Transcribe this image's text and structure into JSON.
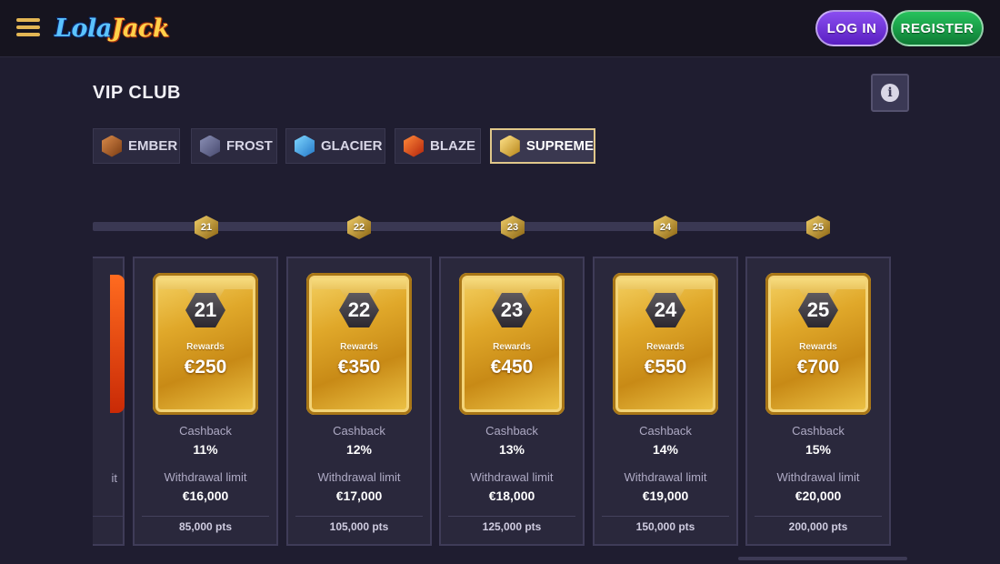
{
  "header": {
    "logo_part1": "Lola",
    "logo_part2": "Jack",
    "login_label": "LOG IN",
    "register_label": "REGISTER"
  },
  "page": {
    "title": "VIP CLUB",
    "info_icon": "i"
  },
  "tabs": [
    {
      "label": "EMBER",
      "icon": "ember-gem-icon"
    },
    {
      "label": "FROST",
      "icon": "frost-gem-icon"
    },
    {
      "label": "GLACIER",
      "icon": "glacier-gem-icon"
    },
    {
      "label": "BLAZE",
      "icon": "blaze-gem-icon"
    },
    {
      "label": "SUPREME",
      "icon": "supreme-gem-icon",
      "active": true
    }
  ],
  "levels": [
    {
      "level": "21",
      "rewards_label": "Rewards",
      "reward": "€250",
      "cashback_label": "Cashback",
      "cashback": "11%",
      "withdrawal_label": "Withdrawal limit",
      "withdrawal": "€16,000",
      "points": "85,000 pts"
    },
    {
      "level": "22",
      "rewards_label": "Rewards",
      "reward": "€350",
      "cashback_label": "Cashback",
      "cashback": "12%",
      "withdrawal_label": "Withdrawal limit",
      "withdrawal": "€17,000",
      "points": "105,000 pts"
    },
    {
      "level": "23",
      "rewards_label": "Rewards",
      "reward": "€450",
      "cashback_label": "Cashback",
      "cashback": "13%",
      "withdrawal_label": "Withdrawal limit",
      "withdrawal": "€18,000",
      "points": "125,000 pts"
    },
    {
      "level": "24",
      "rewards_label": "Rewards",
      "reward": "€550",
      "cashback_label": "Cashback",
      "cashback": "14%",
      "withdrawal_label": "Withdrawal limit",
      "withdrawal": "€19,000",
      "points": "150,000 pts"
    },
    {
      "level": "25",
      "rewards_label": "Rewards",
      "reward": "€700",
      "cashback_label": "Cashback",
      "cashback": "15%",
      "withdrawal_label": "Withdrawal limit",
      "withdrawal": "€20,000",
      "points": "200,000 pts"
    }
  ],
  "partial_card": {
    "label_fragment": "it"
  },
  "colors": {
    "background": "#1f1d30",
    "header": "#16141f",
    "gold": "#e0a82a",
    "login": "#6a2fd8",
    "register": "#169a45"
  }
}
